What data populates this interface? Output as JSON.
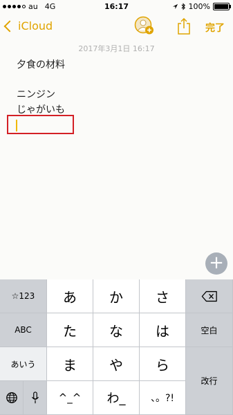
{
  "status": {
    "carrier": "au",
    "network": "4G",
    "time": "16:17",
    "battery_text": "100%"
  },
  "nav": {
    "back_label": "iCloud",
    "done_label": "完了"
  },
  "note": {
    "timestamp": "2017年3月1日 16:17",
    "lines": [
      "夕食の材料",
      "",
      "ニンジン",
      "じゃがいも"
    ]
  },
  "keyboard": {
    "left": [
      "☆123",
      "ABC",
      "あいう"
    ],
    "grid": [
      [
        "あ",
        "か",
        "さ"
      ],
      [
        "た",
        "な",
        "は"
      ],
      [
        "ま",
        "や",
        "ら"
      ],
      [
        "^_^",
        "わ_",
        "、。?!"
      ]
    ],
    "space_label": "空白",
    "return_label": "改行"
  },
  "colors": {
    "accent": "#e0a400",
    "highlight": "#d31f26"
  }
}
